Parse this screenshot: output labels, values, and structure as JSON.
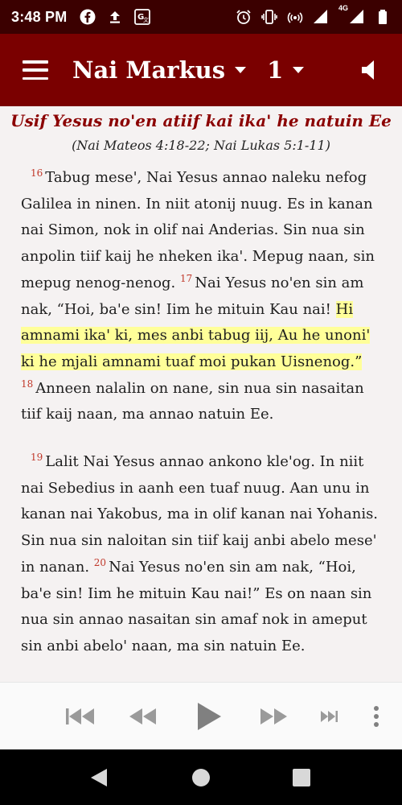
{
  "status_bar": {
    "time": "3:48 PM",
    "network": "4G"
  },
  "app_bar": {
    "book": "Nai Markus",
    "chapter": "1"
  },
  "passage": {
    "heading": "Usif Yesus no'en atiif kai ika' he natuin Ee",
    "reference": "(Nai Mateos 4:18-22; Nai Lukas 5:1-11)",
    "verses": {
      "v16_num": "16",
      "v16_text": "Tabug mese', Nai Yesus annao naleku nefog Galilea in ninen. In niit atonij nuug. Es in kanan nai Simon, nok in olif nai Anderias. Sin nua sin anpolin tiif kaij he nheken ika'. Mepug naan, sin mepug nenog-nenog.",
      "v17_num": "17",
      "v17_text_plain": "Nai Yesus no'en sin am nak, “Hoi, ba'e sin! Iim he mituin Kau nai!",
      "v17_text_highlight": "Hi amnami ika' ki, mes anbi tabug iij, Au he unoni' ki he mjali amnami tuaf moi pukan Uisnenog.”",
      "v18_num": "18",
      "v18_text": "Anneen nalalin on nane, sin nua sin nasaitan tiif kaij naan, ma annao natuin Ee.",
      "v19_num": "19",
      "v19_text": "Lalit Nai Yesus annao ankono kle'og. In niit nai Sebedius in aanh een tuaf nuug. Aan unu in kanan nai Yakobus, ma in olif kanan nai Yohanis. Sin nua sin naloitan sin tiif kaij anbi abelo mese' in nanan.",
      "v20_num": "20",
      "v20_text": "Nai Yesus no'en sin am nak, “Hoi, ba'e sin! Iim he mituin Kau nai!” Es on naan sin nua sin annao nasaitan sin amaf nok in ameput sin anbi abelo' naan, ma sin natuin Ee."
    }
  },
  "colors": {
    "status_bar": "#3b0000",
    "app_bar": "#7a0000",
    "heading": "#8b0000",
    "verse_number": "#c0392b",
    "highlight": "#ffff99"
  },
  "icons": {
    "menu": "menu-icon",
    "speaker": "speaker-icon",
    "skip_start": "skip-to-start-icon",
    "rewind": "rewind-icon",
    "play": "play-icon",
    "fast_forward": "fast-forward-icon",
    "skip_end": "skip-to-end-icon",
    "more": "more-vert-icon"
  }
}
